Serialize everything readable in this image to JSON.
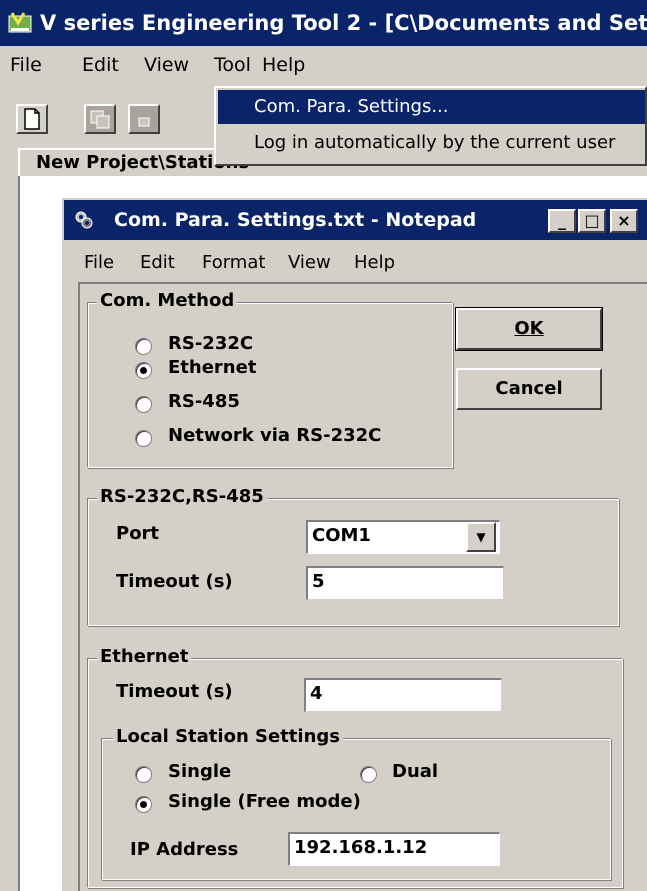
{
  "main_window": {
    "title": "V series Engineering Tool 2 - [C\\Documents and Set",
    "menu": [
      "File",
      "Edit",
      "View",
      "Tool",
      "Help"
    ],
    "breadcrumb": "New Project\\Stations"
  },
  "tool_menu": {
    "items": [
      "Com. Para. Settings...",
      "Log in automatically by the current user"
    ]
  },
  "notepad": {
    "title": "Com. Para. Settings.txt - Notepad",
    "caption_buttons": [
      "_",
      "□",
      "×"
    ],
    "menu": [
      "File",
      "Edit",
      "Format",
      "View",
      "Help"
    ]
  },
  "dialog": {
    "com_method": {
      "label": "Com. Method",
      "options": [
        "RS-232C",
        "Ethernet",
        "RS-485",
        "Network via RS-232C"
      ],
      "selected": "Ethernet"
    },
    "ok_label": "OK",
    "cancel_label": "Cancel",
    "rs_group": {
      "label": "RS-232C,RS-485",
      "port_label": "Port",
      "port_value": "COM1",
      "timeout_label": "Timeout (s)",
      "timeout_value": "5"
    },
    "ethernet_group": {
      "label": "Ethernet",
      "timeout_label": "Timeout (s)",
      "timeout_value": "4",
      "local_station": {
        "label": "Local Station Settings",
        "option_single": "Single",
        "option_dual": "Dual",
        "option_single_free": "Single (Free mode)",
        "selected": "Single (Free mode)",
        "ip_label": "IP Address",
        "ip_value": "192.168.1.12"
      }
    }
  },
  "colors": {
    "titlebar": "#0a246a",
    "face": "#d4d0c8",
    "highlight": "#0a246a"
  }
}
